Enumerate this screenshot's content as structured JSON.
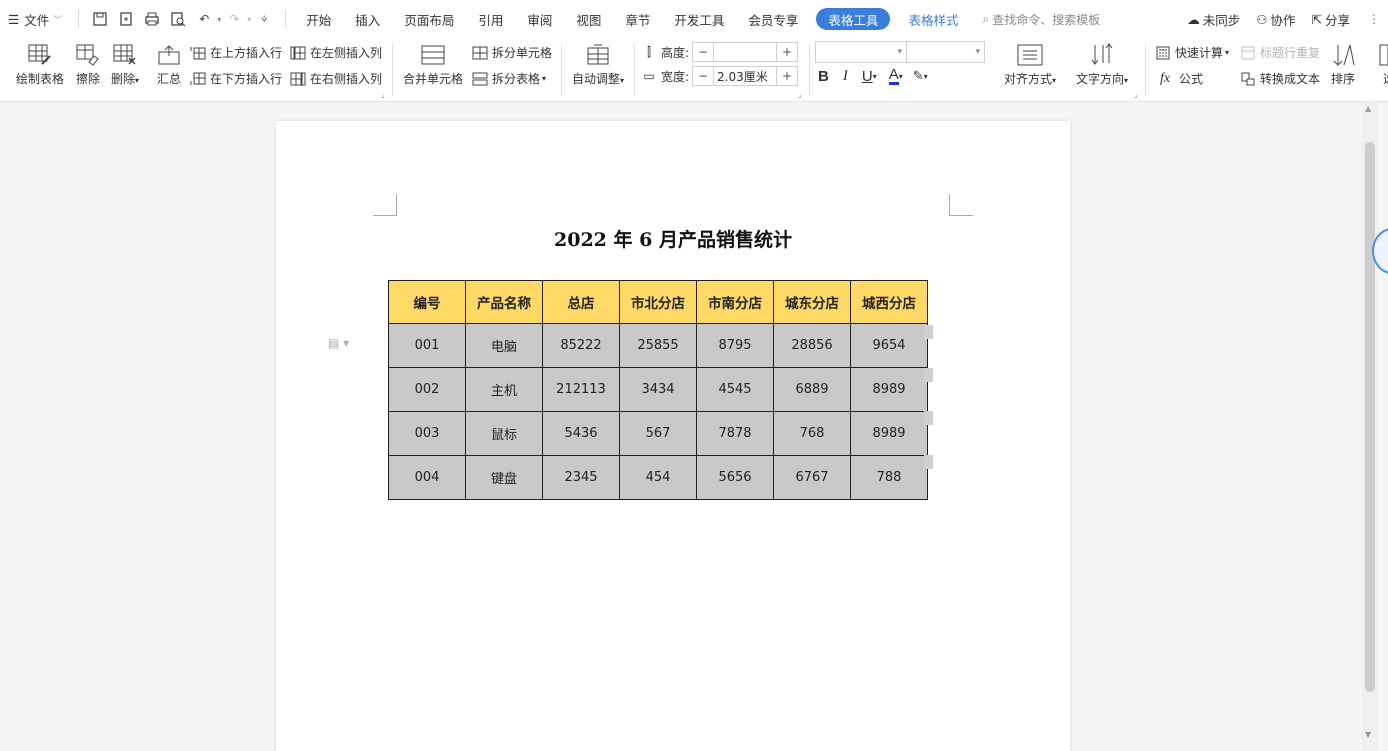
{
  "menubar": {
    "file_label": "文件",
    "tabs": [
      "开始",
      "插入",
      "页面布局",
      "引用",
      "审阅",
      "视图",
      "章节",
      "开发工具",
      "会员专享"
    ],
    "active_tab": "表格工具",
    "style_tab": "表格样式",
    "search_placeholder": "查找命令、搜索模板",
    "sync_label": "未同步",
    "collab_label": "协作",
    "share_label": "分享"
  },
  "ribbon": {
    "draw_table": "绘制表格",
    "erase": "擦除",
    "delete": "删除",
    "summary": "汇总",
    "insert_row_above": "在上方插入行",
    "insert_row_below": "在下方插入行",
    "insert_col_left": "在左侧插入列",
    "insert_col_right": "在右侧插入列",
    "merge_cells": "合并单元格",
    "split_cells": "拆分单元格",
    "split_table": "拆分表格",
    "auto_fit": "自动调整",
    "height_label": "高度:",
    "height_value": "",
    "width_label": "宽度:",
    "width_value": "2.03厘米",
    "align": "对齐方式",
    "text_direction": "文字方向",
    "quick_calc": "快速计算",
    "repeat_header": "标题行重复",
    "formula": "公式",
    "to_text": "转换成文本",
    "sort": "排序",
    "select": "选"
  },
  "document": {
    "title": "2022 年 6 月产品销售统计",
    "headers": [
      "编号",
      "产品名称",
      "总店",
      "市北分店",
      "市南分店",
      "城东分店",
      "城西分店"
    ],
    "rows": [
      [
        "001",
        "电脑",
        "85222",
        "25855",
        "8795",
        "28856",
        "9654"
      ],
      [
        "002",
        "主机",
        "212113",
        "3434",
        "4545",
        "6889",
        "8989"
      ],
      [
        "003",
        "鼠标",
        "5436",
        "567",
        "7878",
        "768",
        "8989"
      ],
      [
        "004",
        "键盘",
        "2345",
        "454",
        "5656",
        "6767",
        "788"
      ]
    ]
  },
  "colors": {
    "header_fill": "#ffd966",
    "cell_fill": "#c9c9c9",
    "accent": "#3b7ddd"
  }
}
